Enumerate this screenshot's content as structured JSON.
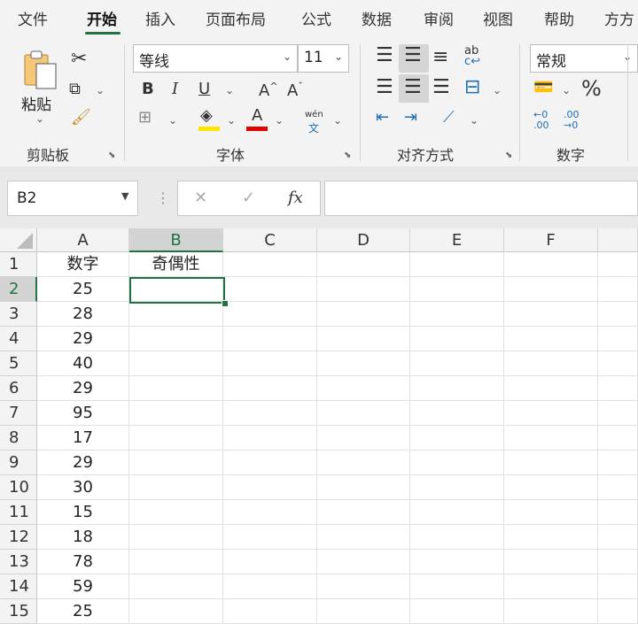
{
  "tabs": [
    {
      "label": "文件"
    },
    {
      "label": "开始",
      "active": true
    },
    {
      "label": "插入"
    },
    {
      "label": "页面布局"
    },
    {
      "label": "公式"
    },
    {
      "label": "数据"
    },
    {
      "label": "审阅"
    },
    {
      "label": "视图"
    },
    {
      "label": "帮助"
    },
    {
      "label": "方方"
    }
  ],
  "ribbon": {
    "clipboard": {
      "paste_label": "粘贴",
      "group_label": "剪贴板"
    },
    "font": {
      "font_name": "等线",
      "font_size": "11",
      "bold": "B",
      "italic": "I",
      "underline": "U",
      "grow": "A",
      "shrink": "A",
      "font_color_letter": "A",
      "phonetic_top": "wén",
      "phonetic_bottom": "文",
      "group_label": "字体"
    },
    "alignment": {
      "group_label": "对齐方式"
    },
    "number": {
      "format": "常规",
      "percent": "%",
      "group_label": "数字"
    }
  },
  "colors": {
    "accent": "#217346",
    "fill_yellow": "#ffe600",
    "font_red": "#e00000"
  },
  "formula_bar": {
    "name_box": "B2",
    "cancel": "✕",
    "enter": "✓",
    "fx": "fx",
    "value": ""
  },
  "sheet": {
    "columns": [
      "A",
      "B",
      "C",
      "D",
      "E",
      "F"
    ],
    "selected_cell": "B2",
    "rows": [
      {
        "num": "1",
        "a": "数字",
        "b": "奇偶性"
      },
      {
        "num": "2",
        "a": "25",
        "b": ""
      },
      {
        "num": "3",
        "a": "28",
        "b": ""
      },
      {
        "num": "4",
        "a": "29",
        "b": ""
      },
      {
        "num": "5",
        "a": "40",
        "b": ""
      },
      {
        "num": "6",
        "a": "29",
        "b": ""
      },
      {
        "num": "7",
        "a": "95",
        "b": ""
      },
      {
        "num": "8",
        "a": "17",
        "b": ""
      },
      {
        "num": "9",
        "a": "29",
        "b": ""
      },
      {
        "num": "10",
        "a": "30",
        "b": ""
      },
      {
        "num": "11",
        "a": "15",
        "b": ""
      },
      {
        "num": "12",
        "a": "18",
        "b": ""
      },
      {
        "num": "13",
        "a": "78",
        "b": ""
      },
      {
        "num": "14",
        "a": "59",
        "b": ""
      },
      {
        "num": "15",
        "a": "25",
        "b": ""
      }
    ]
  }
}
